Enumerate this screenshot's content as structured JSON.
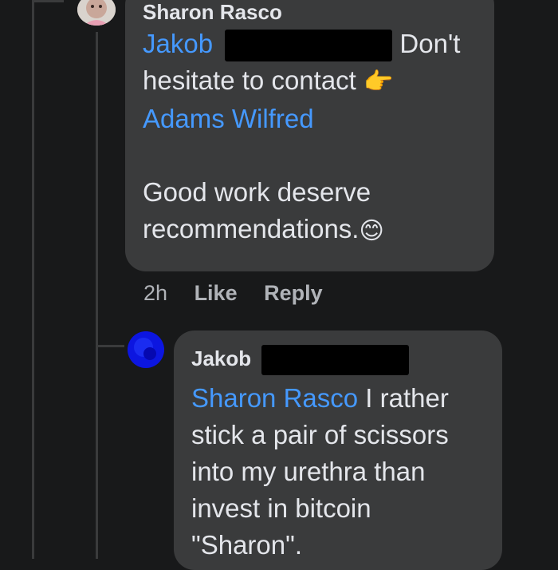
{
  "comment1": {
    "author": "Sharon Rasco",
    "mention1": "Jakob",
    "text1": " Don't",
    "text2": "hesitate to contact",
    "pointing_emoji": "👉",
    "mention2": "Adams Wilfred",
    "text3": "Good work deserve",
    "text4": "recommendations.",
    "smile_emoji": "😊",
    "time": "2h",
    "like_label": "Like",
    "reply_label": "Reply"
  },
  "comment2": {
    "author": "Jakob",
    "mention": "Sharon Rasco",
    "text1": " I rather",
    "text2": "stick a pair of scissors",
    "text3": "into my urethra than",
    "text4": "invest in bitcoin",
    "text5": "\"Sharon\"."
  },
  "colors": {
    "background": "#18191a",
    "bubble": "#3a3b3c",
    "mention": "#4599ff",
    "meta": "#b0b3b8",
    "text": "#e4e6eb"
  }
}
